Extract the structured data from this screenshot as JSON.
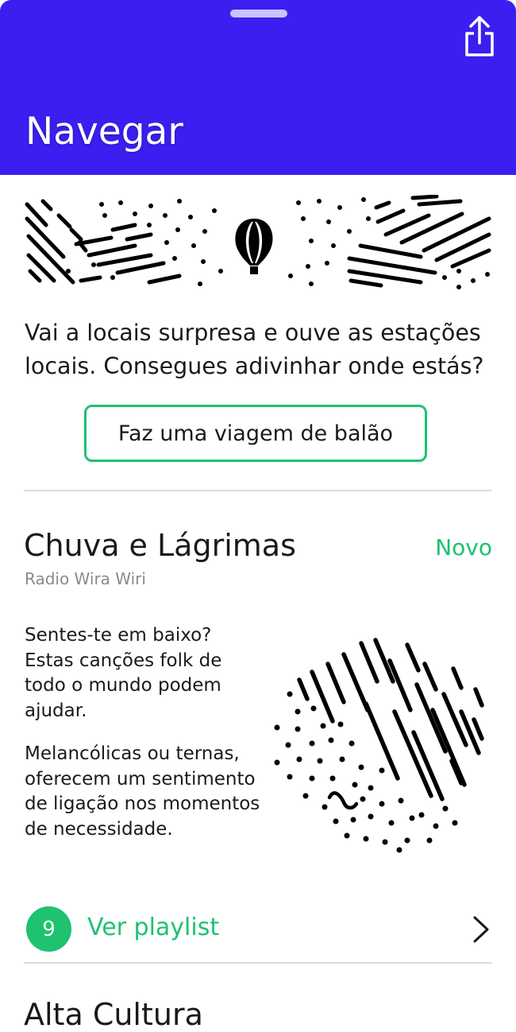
{
  "header": {
    "title": "Navegar",
    "background_color": "#3a1ff0",
    "share_icon": "share-icon"
  },
  "balloon": {
    "icon": "hot-air-balloon-icon",
    "description": "Vai a locais surpresa e ouve as estações locais. Consegues adivinhar onde estás?",
    "button_label": "Faz uma viagem de balão"
  },
  "card": {
    "title": "Chuva e Lágrimas",
    "badge": "Novo",
    "subtitle": "Radio Wira Wiri",
    "paragraphs": [
      "Sentes-te em baixo? Estas canções folk de todo o mundo podem ajudar.",
      "Melancólicas ou ternas, oferecem um sentimento de ligação nos momentos de necessidade."
    ],
    "playlist_count": "9",
    "playlist_label": "Ver playlist",
    "accent_color": "#1ec271"
  },
  "next_card": {
    "title": "Alta Cultura"
  }
}
